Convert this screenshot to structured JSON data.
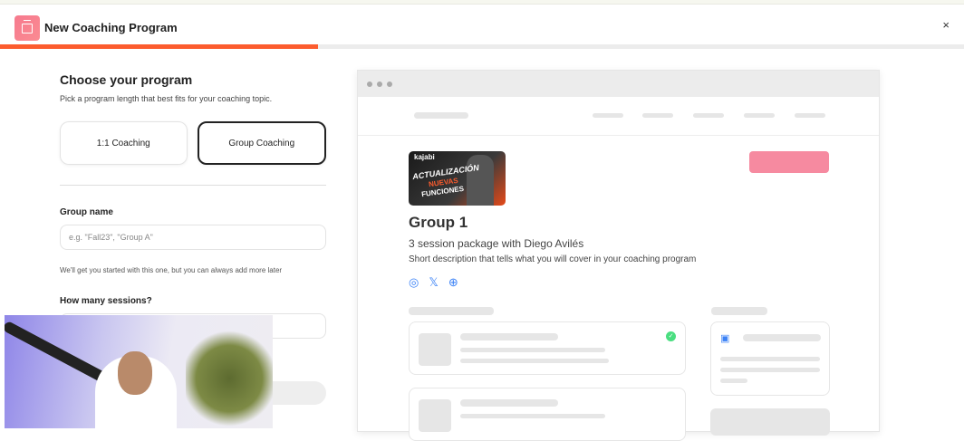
{
  "header": {
    "title": "New Coaching Program",
    "close_icon": "×"
  },
  "progress": {
    "percent": 33
  },
  "form": {
    "heading": "Choose your program",
    "subheading": "Pick a program length that best fits for your coaching topic.",
    "options": [
      {
        "label": "1:1 Coaching",
        "selected": false
      },
      {
        "label": "Group Coaching",
        "selected": true
      }
    ],
    "group_name_label": "Group name",
    "group_name_placeholder": "e.g. \"Fall23\", \"Group A\"",
    "group_name_help": "We'll get you started with this one, but you can always add more later",
    "sessions_label": "How many sessions?"
  },
  "preview": {
    "thumbnail": {
      "brand": "kajabi",
      "line1": "ACTUALIZACIÓN",
      "line2": "NUEVAS",
      "line3": "FUNCIONES"
    },
    "title": "Group 1",
    "subtitle": "3 session package with Diego Avilés",
    "description": "Short description that tells what you will cover in your coaching program",
    "social": [
      "instagram-icon",
      "x-icon",
      "globe-icon"
    ],
    "accent": "#f68aa0"
  }
}
